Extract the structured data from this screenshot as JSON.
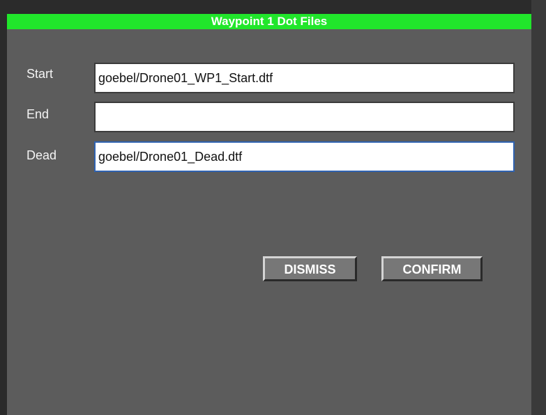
{
  "dialog": {
    "title": "Waypoint 1 Dot Files",
    "title_color": "#21e62b"
  },
  "fields": [
    {
      "label": "Start",
      "value": "goebel/Drone01_WP1_Start.dtf"
    },
    {
      "label": "End",
      "value": ""
    },
    {
      "label": "Dead",
      "value": "goebel/Drone01_Dead.dtf"
    }
  ],
  "buttons": {
    "dismiss": "DISMISS",
    "confirm": "CONFIRM"
  }
}
